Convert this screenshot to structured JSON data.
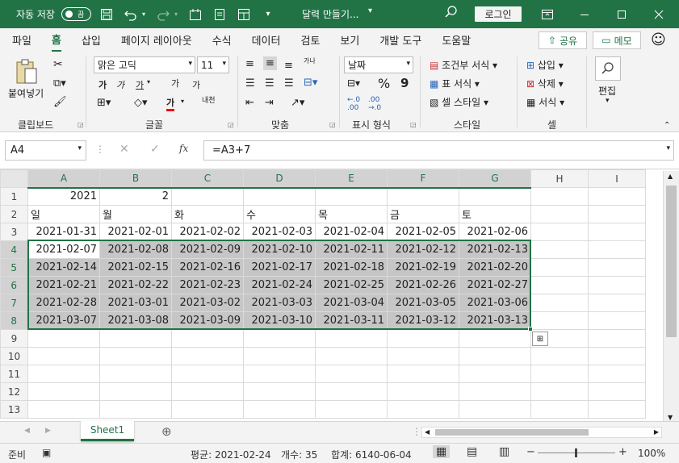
{
  "titlebar": {
    "autosave_label": "자동 저장",
    "autosave_state": "끔",
    "doc_title": "달력 만들기...",
    "login_label": "로그인"
  },
  "menu": {
    "tabs": [
      "파일",
      "홈",
      "삽입",
      "페이지 레이아웃",
      "수식",
      "데이터",
      "검토",
      "보기",
      "개발 도구",
      "도움말"
    ],
    "active_tab": "홈",
    "share_label": "공유",
    "memo_label": "메모"
  },
  "ribbon": {
    "clipboard": {
      "paste_label": "붙여넣기",
      "group_label": "클립보드"
    },
    "font": {
      "font_name": "맑은 고딕",
      "font_size": "11",
      "group_label": "글꼴",
      "bold": "가",
      "italic": "가",
      "underline": "가",
      "grow": "가",
      "shrink": "가",
      "color_letter": "가",
      "phonetic": "내천"
    },
    "alignment": {
      "group_label": "맞춤",
      "wrap": "가나"
    },
    "number": {
      "format": "날짜",
      "percent": "%",
      "comma": "9",
      "group_label": "표시 형식"
    },
    "styles": {
      "cond_format": "조건부 서식",
      "table_format": "표 서식",
      "cell_style": "셀 스타일",
      "group_label": "스타일"
    },
    "cells": {
      "insert": "삽입",
      "delete": "삭제",
      "format": "서식",
      "group_label": "셀"
    },
    "editing": {
      "label": "편집"
    }
  },
  "formula": {
    "name_box": "A4",
    "formula": "=A3+7"
  },
  "grid": {
    "columns": [
      "A",
      "B",
      "C",
      "D",
      "E",
      "F",
      "G",
      "H",
      "I"
    ],
    "rows": [
      [
        "2021",
        "2",
        "",
        "",
        "",
        "",
        "",
        "",
        ""
      ],
      [
        "일",
        "월",
        "화",
        "수",
        "목",
        "금",
        "토",
        "",
        ""
      ],
      [
        "2021-01-31",
        "2021-02-01",
        "2021-02-02",
        "2021-02-03",
        "2021-02-04",
        "2021-02-05",
        "2021-02-06",
        "",
        ""
      ],
      [
        "2021-02-07",
        "2021-02-08",
        "2021-02-09",
        "2021-02-10",
        "2021-02-11",
        "2021-02-12",
        "2021-02-13",
        "",
        ""
      ],
      [
        "2021-02-14",
        "2021-02-15",
        "2021-02-16",
        "2021-02-17",
        "2021-02-18",
        "2021-02-19",
        "2021-02-20",
        "",
        ""
      ],
      [
        "2021-02-21",
        "2021-02-22",
        "2021-02-23",
        "2021-02-24",
        "2021-02-25",
        "2021-02-26",
        "2021-02-27",
        "",
        ""
      ],
      [
        "2021-02-28",
        "2021-03-01",
        "2021-03-02",
        "2021-03-03",
        "2021-03-04",
        "2021-03-05",
        "2021-03-06",
        "",
        ""
      ],
      [
        "2021-03-07",
        "2021-03-08",
        "2021-03-09",
        "2021-03-10",
        "2021-03-11",
        "2021-03-12",
        "2021-03-13",
        "",
        ""
      ],
      [
        "",
        "",
        "",
        "",
        "",
        "",
        "",
        "",
        ""
      ],
      [
        "",
        "",
        "",
        "",
        "",
        "",
        "",
        "",
        ""
      ],
      [
        "",
        "",
        "",
        "",
        "",
        "",
        "",
        "",
        ""
      ],
      [
        "",
        "",
        "",
        "",
        "",
        "",
        "",
        "",
        ""
      ],
      [
        "",
        "",
        "",
        "",
        "",
        "",
        "",
        "",
        ""
      ]
    ],
    "row_numbers": [
      "1",
      "2",
      "3",
      "4",
      "5",
      "6",
      "7",
      "8",
      "9",
      "10",
      "11",
      "12",
      "13"
    ]
  },
  "sheets": {
    "tabs": [
      "Sheet1"
    ],
    "active": "Sheet1"
  },
  "status": {
    "ready": "준비",
    "average": "평균: 2021-02-24",
    "count": "개수: 35",
    "sum": "합계: 6140-06-04",
    "zoom": "100%",
    "zoom_plus": "+",
    "zoom_minus": "−"
  },
  "colors": {
    "accent": "#217346",
    "selection_fill": "#c6c6c6"
  }
}
